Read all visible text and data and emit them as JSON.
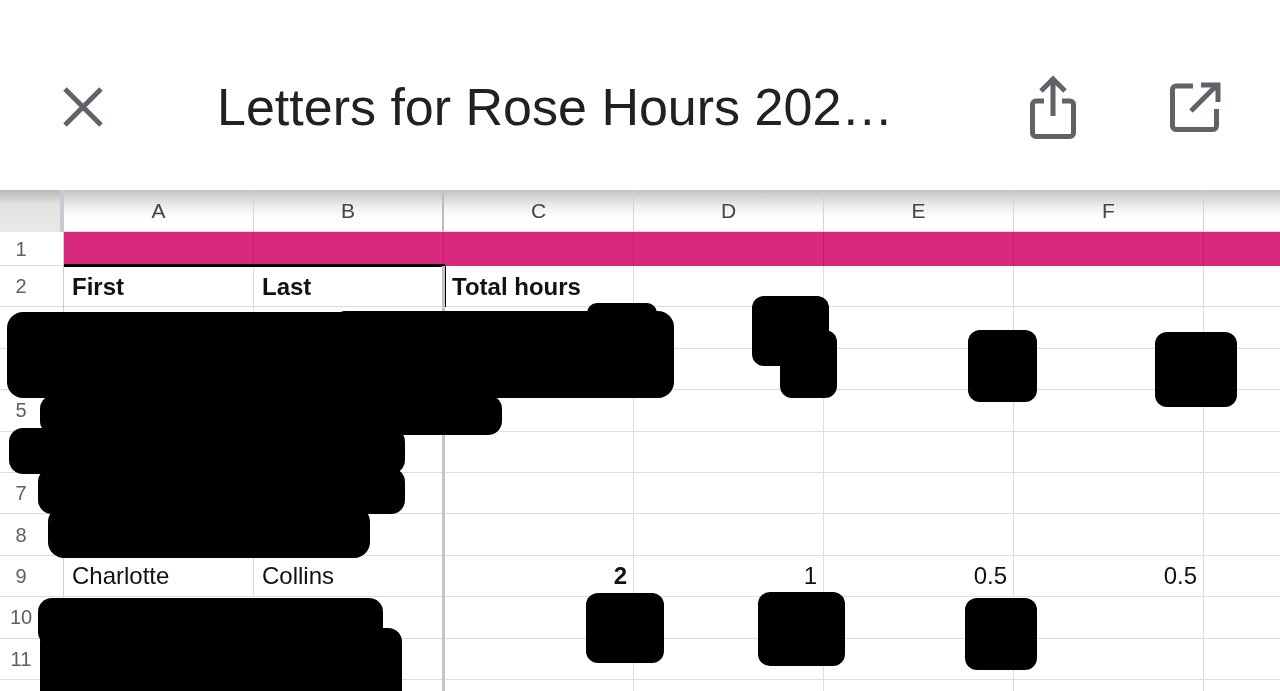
{
  "toolbar": {
    "title": "Letters for Rose Hours 202…"
  },
  "sheet": {
    "columns": [
      {
        "label": "A",
        "frozen": false
      },
      {
        "label": "B",
        "frozen": true
      },
      {
        "label": "C",
        "frozen": false
      },
      {
        "label": "D",
        "frozen": false
      },
      {
        "label": "E",
        "frozen": false
      },
      {
        "label": "F",
        "frozen": false
      }
    ],
    "rows": [
      {
        "number": "1",
        "kind": "band",
        "color": "#d9297f"
      },
      {
        "number": "2",
        "kind": "cells",
        "cells": [
          {
            "text": "First",
            "kind": "text",
            "bold": true,
            "border_top": true,
            "border_right": false
          },
          {
            "text": "Last",
            "kind": "text",
            "bold": true,
            "border_top": true,
            "border_right": true
          },
          {
            "text": "Total hours",
            "kind": "text",
            "bold": true,
            "border_top": false,
            "border_right": false
          }
        ]
      },
      {
        "kind": "cells"
      },
      {
        "kind": "cells"
      },
      {
        "number": "5",
        "kind": "cells"
      },
      {
        "kind": "cells"
      },
      {
        "number": "7",
        "kind": "cells"
      },
      {
        "number": "8",
        "kind": "cells"
      },
      {
        "number": "9",
        "kind": "cells",
        "cells": [
          {
            "text": "Charlotte",
            "kind": "text",
            "bold": false,
            "border_top": false,
            "border_right": false
          },
          {
            "text": "Collins",
            "kind": "text",
            "bold": false,
            "border_top": false,
            "border_right": false
          },
          {
            "text": "2",
            "kind": "number",
            "bold": true,
            "border_top": false,
            "border_right": false
          },
          {
            "text": "1",
            "kind": "number",
            "bold": false,
            "border_top": false,
            "border_right": false
          },
          {
            "text": "0.5",
            "kind": "number",
            "bold": false,
            "border_top": false,
            "border_right": false
          },
          {
            "text": "0.5",
            "kind": "number",
            "bold": false,
            "border_top": false,
            "border_right": false
          }
        ]
      },
      {
        "number": "10",
        "kind": "cells"
      },
      {
        "number": "11",
        "kind": "cells"
      }
    ]
  }
}
